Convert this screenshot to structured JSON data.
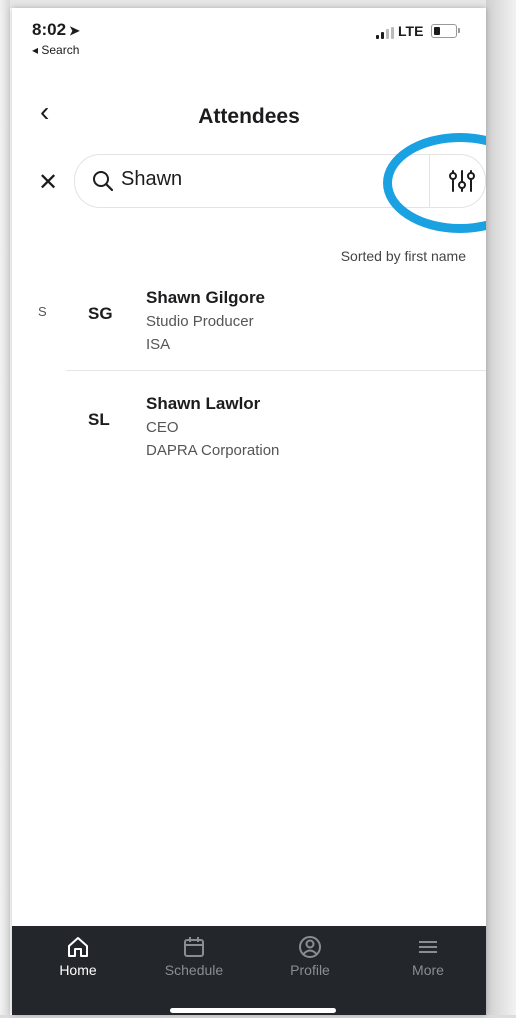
{
  "status_bar": {
    "time": "8:02",
    "back_app": "◂ Search",
    "network": "LTE"
  },
  "header": {
    "title": "Attendees"
  },
  "search": {
    "value": "Shawn"
  },
  "list": {
    "sort_label": "Sorted by first name",
    "index_letter": "S",
    "items": [
      {
        "initials": "SG",
        "name": "Shawn Gilgore",
        "title": "Studio Producer",
        "company": "ISA"
      },
      {
        "initials": "SL",
        "name": "Shawn Lawlor",
        "title": "CEO",
        "company": "DAPRA Corporation"
      }
    ]
  },
  "tabs": [
    {
      "label": "Home",
      "icon": "home-icon",
      "active": true
    },
    {
      "label": "Schedule",
      "icon": "calendar-icon",
      "active": false
    },
    {
      "label": "Profile",
      "icon": "profile-icon",
      "active": false
    },
    {
      "label": "More",
      "icon": "menu-icon",
      "active": false
    }
  ],
  "colors": {
    "highlight_ring": "#1aa1e2",
    "tabbar_bg": "#23272b"
  }
}
